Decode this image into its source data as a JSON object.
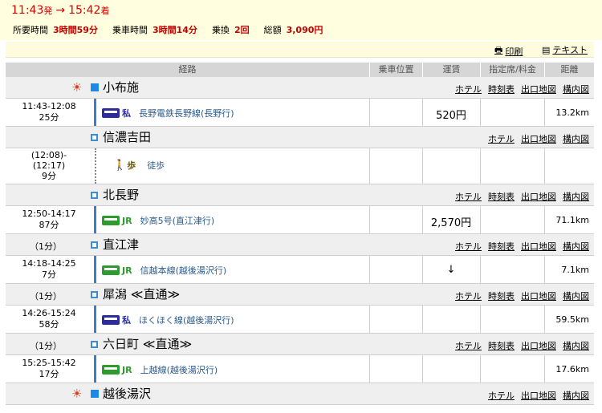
{
  "header": {
    "depart_time": "11:43",
    "depart_suffix": "発",
    "arrow": "→",
    "arrive_time": "15:42",
    "arrive_suffix": "着",
    "summary": [
      {
        "label": "所要時間",
        "value": "3時間59分"
      },
      {
        "label": "乗車時間",
        "value": "3時間14分"
      },
      {
        "label": "乗換",
        "value": "2回"
      },
      {
        "label": "総額",
        "value": "3,090円"
      }
    ],
    "print_label": "印刷",
    "text_label": "テキスト"
  },
  "columns": [
    "経路",
    "乗車位置",
    "運賃",
    "指定席/料金",
    "距離"
  ],
  "link_labels": {
    "hotel": "ホテル",
    "timetable": "時刻表",
    "exitmap": "出口地図",
    "premises": "構内図"
  },
  "stations": [
    {
      "name": "小布施",
      "duration": "",
      "links": [
        "hotel",
        "timetable",
        "exitmap",
        "premises"
      ]
    },
    {
      "name": "信濃吉田",
      "duration": "",
      "links": [
        "hotel",
        "exitmap",
        "premises"
      ]
    },
    {
      "name": "北長野",
      "duration": "",
      "links": [
        "hotel",
        "timetable",
        "exitmap",
        "premises"
      ]
    },
    {
      "name": "直江津",
      "duration": "（1分）",
      "links": [
        "hotel",
        "timetable",
        "exitmap",
        "premises"
      ]
    },
    {
      "name": "犀潟 ≪直通≫",
      "duration": "（1分）",
      "links": [
        "hotel",
        "timetable",
        "exitmap",
        "premises"
      ]
    },
    {
      "name": "六日町 ≪直通≫",
      "duration": "（1分）",
      "links": [
        "hotel",
        "timetable",
        "exitmap",
        "premises"
      ]
    },
    {
      "name": "越後湯沢",
      "duration": "",
      "links": [
        "hotel",
        "exitmap",
        "premises"
      ]
    }
  ],
  "segments": [
    {
      "time": "11:43-12:08",
      "dur": "25分",
      "badge": "私",
      "line": "長野電鉄長野線(長野行)",
      "fare": "520円",
      "dist": "13.2km"
    },
    {
      "time1": "(12:08)-",
      "time2": "(12:17)",
      "dur": "9分",
      "badge": "歩",
      "line": "徒歩",
      "fare": "",
      "dist": ""
    },
    {
      "time": "12:50-14:17",
      "dur": "87分",
      "badge": "JR",
      "line": "妙高5号(直江津行)",
      "fare": "2,570円",
      "dist": "71.1km"
    },
    {
      "time": "14:18-14:25",
      "dur": "7分",
      "badge": "JR",
      "line": "信越本線(越後湯沢行)",
      "fare": "↓",
      "dist": "7.1km"
    },
    {
      "time": "14:26-15:24",
      "dur": "58分",
      "badge": "私",
      "line": "ほくほく線(越後湯沢行)",
      "fare": "",
      "dist": "59.5km"
    },
    {
      "time": "15:25-15:42",
      "dur": "17分",
      "badge": "JR",
      "line": "上越線(越後湯沢行)",
      "fare": "",
      "dist": "17.6km"
    }
  ]
}
